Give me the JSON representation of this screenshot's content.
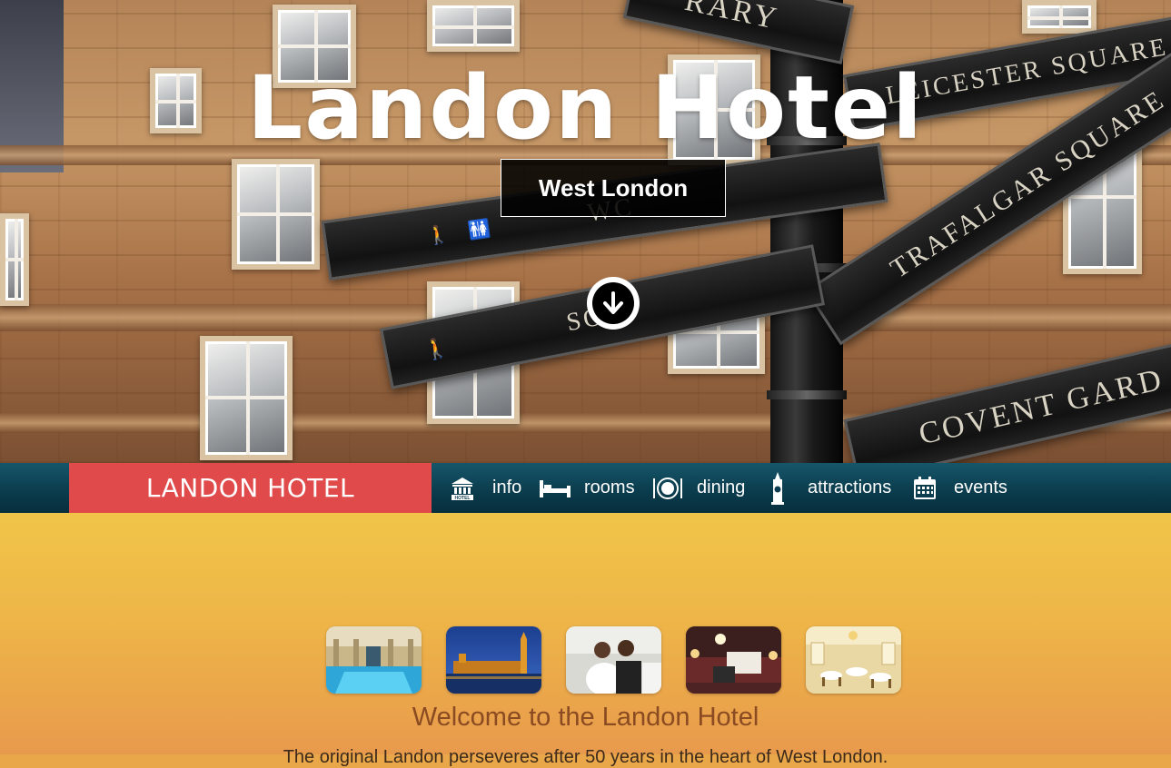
{
  "hero": {
    "title": "Landon Hotel",
    "location": "West London",
    "scroll_icon": "arrow-down-circle-icon",
    "signs": [
      "RARY",
      "LEICESTER SQUARE",
      "TRAFALGAR SQUARE",
      "WC",
      "SO",
      "COVENT GARD"
    ]
  },
  "nav": {
    "brand": "LANDON HOTEL",
    "items": [
      {
        "label": "info",
        "icon": "hotel-icon"
      },
      {
        "label": "rooms",
        "icon": "bed-icon"
      },
      {
        "label": "dining",
        "icon": "plate-icon"
      },
      {
        "label": "attractions",
        "icon": "big-ben-icon"
      },
      {
        "label": "events",
        "icon": "calendar-icon"
      }
    ]
  },
  "content": {
    "thumbnails": [
      "pool-thumbnail",
      "parliament-thumbnail",
      "wedding-thumbnail",
      "bedroom-thumbnail",
      "banquet-hall-thumbnail"
    ],
    "welcome": "Welcome to the Landon Hotel",
    "intro": "The original Landon perseveres after 50 years in the heart of West London."
  },
  "colors": {
    "brand_red": "#e04a4a",
    "nav_teal": "#0b3d4e",
    "welcome_text": "#8a4a22"
  }
}
